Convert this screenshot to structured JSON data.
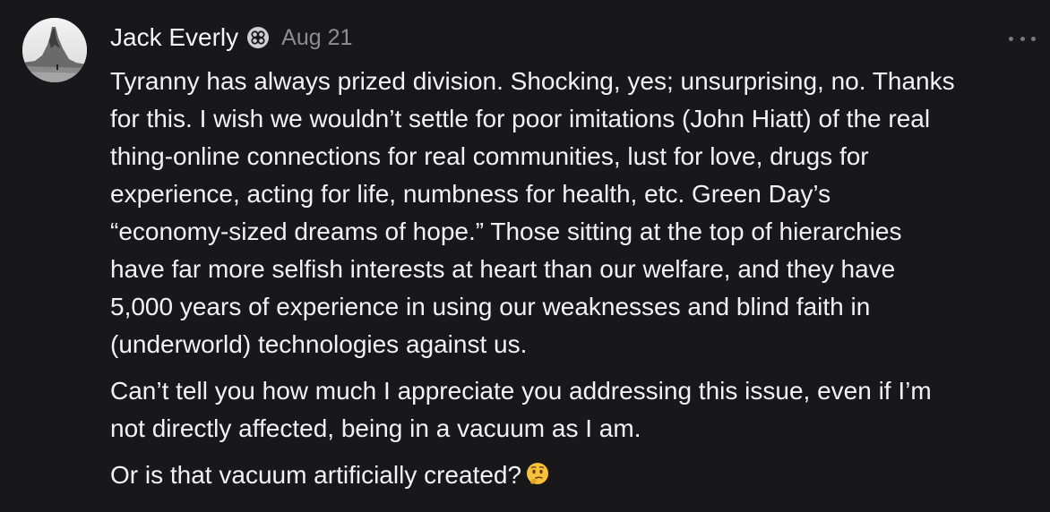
{
  "comment": {
    "author": "Jack Everly",
    "date": "Aug 21",
    "badge_icon": "subscriber-badge-icon",
    "more_icon": "more-options-icon",
    "paragraphs": [
      {
        "lines": [
          "Tyranny has always prized division. Shocking, yes; unsurprising, no. Thanks",
          "for this. I wish we wouldn’t settle for poor imitations (John Hiatt) of the real",
          "thing-online connections for real communities, lust for love, drugs for",
          "experience, acting for life, numbness for health, etc. Green Day’s",
          "“economy-sized dreams of hope.” Those sitting at the top of hierarchies",
          "have far more selfish interests at heart than our welfare, and they have",
          "5,000 years of experience in using our weaknesses and blind faith in",
          "(underworld) technologies against us."
        ]
      },
      {
        "lines": [
          "Can’t tell you how much I appreciate you addressing this issue, even if I’m",
          "not directly affected, being in a vacuum as I am."
        ]
      },
      {
        "lines": [
          "Or is that vacuum artificially created?"
        ],
        "emoji": "thinking-face-emoji"
      }
    ]
  }
}
